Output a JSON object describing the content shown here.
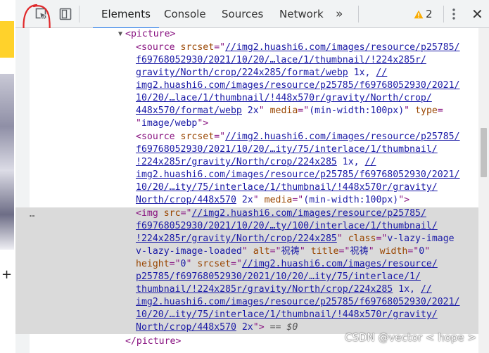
{
  "toolbar": {
    "tabs": [
      {
        "label": "Elements",
        "active": true
      },
      {
        "label": "Console",
        "active": false
      },
      {
        "label": "Sources",
        "active": false
      },
      {
        "label": "Network",
        "active": false
      }
    ],
    "more_label": "»",
    "warning_count": "2",
    "close_label": "✕",
    "accent_color": "#1a73e8",
    "warning_color": "#f9ab00",
    "icons": [
      "inspect-element-icon",
      "device-toolbar-icon",
      "warning-icon",
      "kebab-menu-icon",
      "close-icon"
    ]
  },
  "annotation": {
    "color": "#e0292b"
  },
  "elements": {
    "picture_open": "picture",
    "source1": {
      "tag": "source",
      "srcset_attr": "srcset",
      "srcset_l1": "//img2.huashi6.com/images/resource/p25785/",
      "srcset_l2": "f69768052930/2021/10/20/…lace/1/thumbnail/!224x285r/",
      "srcset_l3": "gravity/North/crop/224x285/format/webp",
      "d1": " 1x, ",
      "srcset_l3b": "//",
      "srcset_l4": "img2.huashi6.com/images/resource/p25785/f69768052930/2021/",
      "srcset_l5": "10/20/…lace/1/thumbnail/!448x570r/gravity/North/crop/",
      "srcset_l6": "448x570/format/webp",
      "d2": " 2x",
      "media_attr": "media",
      "media_val": "(min-width:100px)",
      "type_attr": "type",
      "type_val": "image/webp"
    },
    "source2": {
      "tag": "source",
      "srcset_attr": "srcset",
      "srcset_l1": "//img2.huashi6.com/images/resource/p25785/",
      "srcset_l2": "f69768052930/2021/10/20/…ity/75/interlace/1/thumbnail/",
      "srcset_l3": "!224x285r/gravity/North/crop/224x285",
      "d1": " 1x, ",
      "srcset_l3b": "//",
      "srcset_l4": "img2.huashi6.com/images/resource/p25785/f69768052930/2021/",
      "srcset_l5": "10/20/…ity/75/interlace/1/thumbnail/!448x570r/gravity/",
      "srcset_l6": "North/crop/448x570",
      "d2": " 2x",
      "media_attr": "media",
      "media_val": "(min-width:100px)"
    },
    "img": {
      "tag": "img",
      "src_attr": "src",
      "src_l1": "//img2.huashi6.com/images/resource/p25785/",
      "src_l2": "f69768052930/2021/10/20/…ty/100/interlace/1/thumbnail/",
      "src_l3": "!224x285r/gravity/North/crop/224x285",
      "class_attr": "class",
      "class_val_1": "v-lazy-image",
      "class_val_2": "v-lazy-image-loaded",
      "alt_attr": "alt",
      "alt_val": "祝祷",
      "title_attr": "title",
      "title_val": "祝祷",
      "width_attr": "width",
      "width_val": "0",
      "height_attr": "height",
      "height_val": "0",
      "srcset_attr": "srcset",
      "srcset_l1": "//img2.huashi6.com/images/resource/",
      "srcset_l2": "p25785/f69768052930/2021/10/20/…ity/75/interlace/1/",
      "srcset_l3": "thumbnail/!224x285r/gravity/North/crop/224x285",
      "d1": " 1x, ",
      "srcset_l3b": "//",
      "srcset_l4": "img2.huashi6.com/images/resource/p25785/f69768052930/2021/",
      "srcset_l5": "10/20/…ity/75/interlace/1/thumbnail/!448x570r/gravity/",
      "srcset_l6": "North/crop/448x570",
      "d2": " 2x",
      "dollar": "== $0"
    },
    "picture_close": "/picture",
    "gutter_ellipsis": "…"
  },
  "watermark": "CSDN @vector < hope >"
}
